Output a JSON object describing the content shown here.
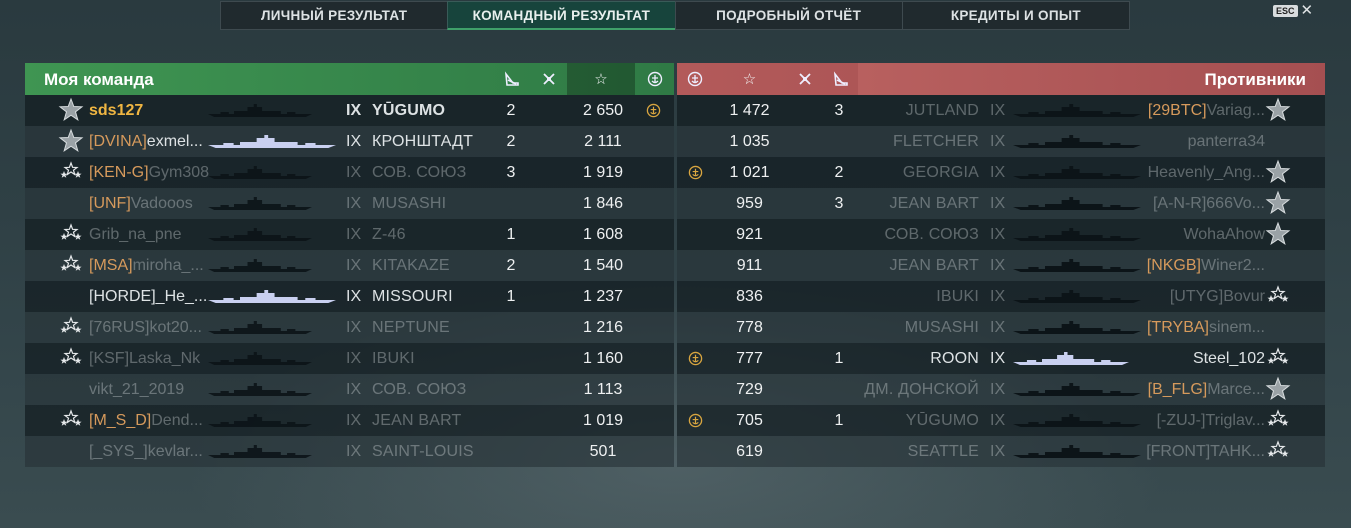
{
  "tabs": [
    "ЛИЧНЫЙ РЕЗУЛЬТАТ",
    "КОМАНДНЫЙ РЕЗУЛЬТАТ",
    "ПОДРОБНЫЙ ОТЧЁТ",
    "КРЕДИТЫ И ОПЫТ"
  ],
  "active_tab": 1,
  "esc_label": "ESC",
  "close_glyph": "✕",
  "my_team": {
    "title": "Моя команда",
    "players": [
      {
        "clan": "",
        "name": "sds127",
        "tier": "IX",
        "ship": "YŪGUMO",
        "kills": "2",
        "exp": "2 650",
        "cap": true,
        "highlight": true,
        "dim": false,
        "rank": "silver"
      },
      {
        "clan": "[DVINA]",
        "name": "exmel...",
        "tier": "IX",
        "ship": "КРОНШТАДТ",
        "kills": "2",
        "exp": "2 111",
        "cap": false,
        "highlight": false,
        "dim": false,
        "rank": "silver"
      },
      {
        "clan": "[KEN-G]",
        "name": "Gym308",
        "tier": "IX",
        "ship": "СОВ. СОЮЗ",
        "kills": "3",
        "exp": "1 919",
        "cap": false,
        "highlight": false,
        "dim": true,
        "rank": "stars"
      },
      {
        "clan": "[UNF]",
        "name": "Vadooos",
        "tier": "IX",
        "ship": "MUSASHI",
        "kills": "",
        "exp": "1 846",
        "cap": false,
        "highlight": false,
        "dim": true,
        "rank": "none"
      },
      {
        "clan": "",
        "name": "Grib_na_pne",
        "tier": "IX",
        "ship": "Z-46",
        "kills": "1",
        "exp": "1 608",
        "cap": false,
        "highlight": false,
        "dim": true,
        "rank": "stars"
      },
      {
        "clan": "[MSA]",
        "name": "miroha_...",
        "tier": "IX",
        "ship": "KITAKAZE",
        "kills": "2",
        "exp": "1 540",
        "cap": false,
        "highlight": false,
        "dim": true,
        "rank": "stars"
      },
      {
        "clan": "",
        "name": "[HORDE]_He_...",
        "tier": "IX",
        "ship": "MISSOURI",
        "kills": "1",
        "exp": "1 237",
        "cap": false,
        "highlight": false,
        "dim": false,
        "rank": "none"
      },
      {
        "clan": "",
        "name": "[76RUS]kot20...",
        "tier": "IX",
        "ship": "NEPTUNE",
        "kills": "",
        "exp": "1 216",
        "cap": false,
        "highlight": false,
        "dim": true,
        "rank": "stars"
      },
      {
        "clan": "",
        "name": "[KSF]Laska_Nk",
        "tier": "IX",
        "ship": "IBUKI",
        "kills": "",
        "exp": "1 160",
        "cap": false,
        "highlight": false,
        "dim": true,
        "rank": "stars"
      },
      {
        "clan": "",
        "name": "vikt_21_2019",
        "tier": "IX",
        "ship": "СОВ. СОЮЗ",
        "kills": "",
        "exp": "1 113",
        "cap": false,
        "highlight": false,
        "dim": true,
        "rank": "none"
      },
      {
        "clan": "[M_S_D]",
        "name": "Dend...",
        "tier": "IX",
        "ship": "JEAN BART",
        "kills": "",
        "exp": "1 019",
        "cap": false,
        "highlight": false,
        "dim": true,
        "rank": "stars"
      },
      {
        "clan": "",
        "name": "[_SYS_]kevlar...",
        "tier": "IX",
        "ship": "SAINT-LOUIS",
        "kills": "",
        "exp": "501",
        "cap": false,
        "highlight": false,
        "dim": true,
        "rank": "none"
      }
    ]
  },
  "enemy_team": {
    "title": "Противники",
    "players": [
      {
        "clan": "[29BTC]",
        "name": "Variag...",
        "tier": "IX",
        "ship": "JUTLAND",
        "kills": "3",
        "exp": "1 472",
        "cap": false,
        "dim": true,
        "rank": "silver"
      },
      {
        "clan": "",
        "name": "panterra34",
        "tier": "IX",
        "ship": "FLETCHER",
        "kills": "",
        "exp": "1 035",
        "cap": false,
        "dim": true,
        "rank": "none"
      },
      {
        "clan": "",
        "name": "Heavenly_Ang...",
        "tier": "IX",
        "ship": "GEORGIA",
        "kills": "2",
        "exp": "1 021",
        "cap": true,
        "dim": true,
        "rank": "silver"
      },
      {
        "clan": "",
        "name": "[A-N-R]666Vo...",
        "tier": "IX",
        "ship": "JEAN BART",
        "kills": "3",
        "exp": "959",
        "cap": false,
        "dim": true,
        "rank": "silver"
      },
      {
        "clan": "",
        "name": "WohaAhow",
        "tier": "IX",
        "ship": "СОВ. СОЮЗ",
        "kills": "",
        "exp": "921",
        "cap": false,
        "dim": true,
        "rank": "silver"
      },
      {
        "clan": "[NKGB]",
        "name": "Winer2...",
        "tier": "IX",
        "ship": "JEAN BART",
        "kills": "",
        "exp": "911",
        "cap": false,
        "dim": true,
        "rank": "none"
      },
      {
        "clan": "",
        "name": "[UTYG]Bovur",
        "tier": "IX",
        "ship": "IBUKI",
        "kills": "",
        "exp": "836",
        "cap": false,
        "dim": true,
        "rank": "stars"
      },
      {
        "clan": "[TRYBA]",
        "name": "sinem...",
        "tier": "IX",
        "ship": "MUSASHI",
        "kills": "",
        "exp": "778",
        "cap": false,
        "dim": true,
        "rank": "none"
      },
      {
        "clan": "",
        "name": "Steel_102",
        "tier": "IX",
        "ship": "ROON",
        "kills": "1",
        "exp": "777",
        "cap": true,
        "dim": false,
        "rank": "stars"
      },
      {
        "clan": "[B_FLG]",
        "name": "Marce...",
        "tier": "IX",
        "ship": "ДМ. ДОНСКОЙ",
        "kills": "",
        "exp": "729",
        "cap": false,
        "dim": true,
        "rank": "silver"
      },
      {
        "clan": "",
        "name": "[-ZUJ-]Triglav...",
        "tier": "IX",
        "ship": "YŪGUMO",
        "kills": "1",
        "exp": "705",
        "cap": true,
        "dim": true,
        "rank": "stars"
      },
      {
        "clan": "",
        "name": "[FRONT]TAHK...",
        "tier": "IX",
        "ship": "SEATTLE",
        "kills": "",
        "exp": "619",
        "cap": false,
        "dim": true,
        "rank": "stars"
      }
    ]
  },
  "colors": {
    "ally_header": "#3f9552",
    "enemy_header": "#b35a5a",
    "clan": "#d69a5c",
    "self": "#f0b642",
    "cap_icon": "#d9a640"
  },
  "header_icons": [
    "ship-destroyed-icon",
    "planes-destroyed-icon",
    "base-xp-icon",
    "capture-icon"
  ]
}
